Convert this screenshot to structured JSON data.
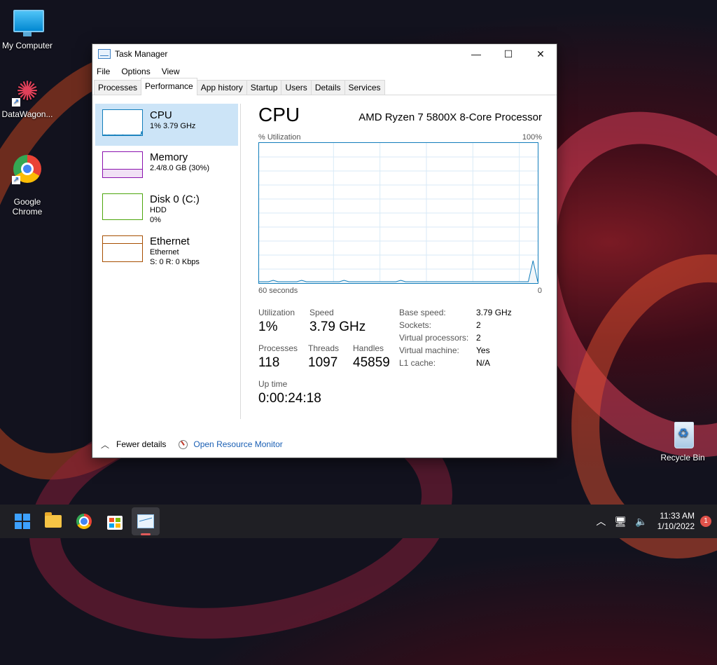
{
  "desktop": {
    "icons": [
      {
        "label": "My Computer"
      },
      {
        "label": "DataWagon..."
      },
      {
        "label": "Google\nChrome"
      },
      {
        "label": "Recycle Bin"
      }
    ]
  },
  "window": {
    "title": "Task Manager",
    "controls": {
      "minimize": "—",
      "maximize": "☐",
      "close": "✕"
    },
    "menu": [
      "File",
      "Options",
      "View"
    ],
    "tabs": [
      "Processes",
      "Performance",
      "App history",
      "Startup",
      "Users",
      "Details",
      "Services"
    ],
    "active_tab": "Performance"
  },
  "sidebar": {
    "items": [
      {
        "name": "CPU",
        "line1": "1% 3.79 GHz",
        "line2": "",
        "color": "#117dbb",
        "selected": true
      },
      {
        "name": "Memory",
        "line1": "2.4/8.0 GB (30%)",
        "line2": "",
        "color": "#8b12ae",
        "level": 0.3
      },
      {
        "name": "Disk 0 (C:)",
        "line1": "HDD",
        "line2": "0%",
        "color": "#4da60c"
      },
      {
        "name": "Ethernet",
        "line1": "Ethernet",
        "line2": "S: 0 R: 0 Kbps",
        "color": "#a74f01"
      }
    ]
  },
  "cpu": {
    "heading": "CPU",
    "processor": "AMD Ryzen 7 5800X 8-Core Processor",
    "axis_top_left": "% Utilization",
    "axis_top_right": "100%",
    "axis_bottom_left": "60 seconds",
    "axis_bottom_right": "0",
    "graph_color": "#117dbb",
    "utilization_history": [
      1,
      1,
      1,
      2,
      1,
      1,
      1,
      1,
      1,
      2,
      1,
      1,
      1,
      1,
      1,
      1,
      1,
      1,
      2,
      1,
      1,
      1,
      1,
      1,
      1,
      1,
      1,
      1,
      1,
      1,
      2,
      1,
      1,
      1,
      1,
      1,
      1,
      1,
      1,
      1,
      1,
      1,
      1,
      1,
      1,
      1,
      1,
      1,
      1,
      1,
      1,
      1,
      1,
      1,
      1,
      1,
      1,
      1,
      16,
      1
    ],
    "stats": {
      "utilization_label": "Utilization",
      "utilization": "1%",
      "speed_label": "Speed",
      "speed": "3.79 GHz",
      "processes_label": "Processes",
      "processes": "118",
      "threads_label": "Threads",
      "threads": "1097",
      "handles_label": "Handles",
      "handles": "45859",
      "uptime_label": "Up time",
      "uptime": "0:00:24:18"
    },
    "details": [
      {
        "key": "Base speed:",
        "value": "3.79 GHz"
      },
      {
        "key": "Sockets:",
        "value": "2"
      },
      {
        "key": "Virtual processors:",
        "value": "2"
      },
      {
        "key": "Virtual machine:",
        "value": "Yes"
      },
      {
        "key": "L1 cache:",
        "value": "N/A"
      }
    ]
  },
  "footer": {
    "fewer_details": "Fewer details",
    "open_resource_monitor": "Open Resource Monitor"
  },
  "taskbar": {
    "icons": [
      "start-icon",
      "file-explorer-icon",
      "chrome-icon",
      "store-icon",
      "task-manager-icon"
    ],
    "time": "11:33 AM",
    "date": "1/10/2022",
    "notification_count": "1"
  }
}
